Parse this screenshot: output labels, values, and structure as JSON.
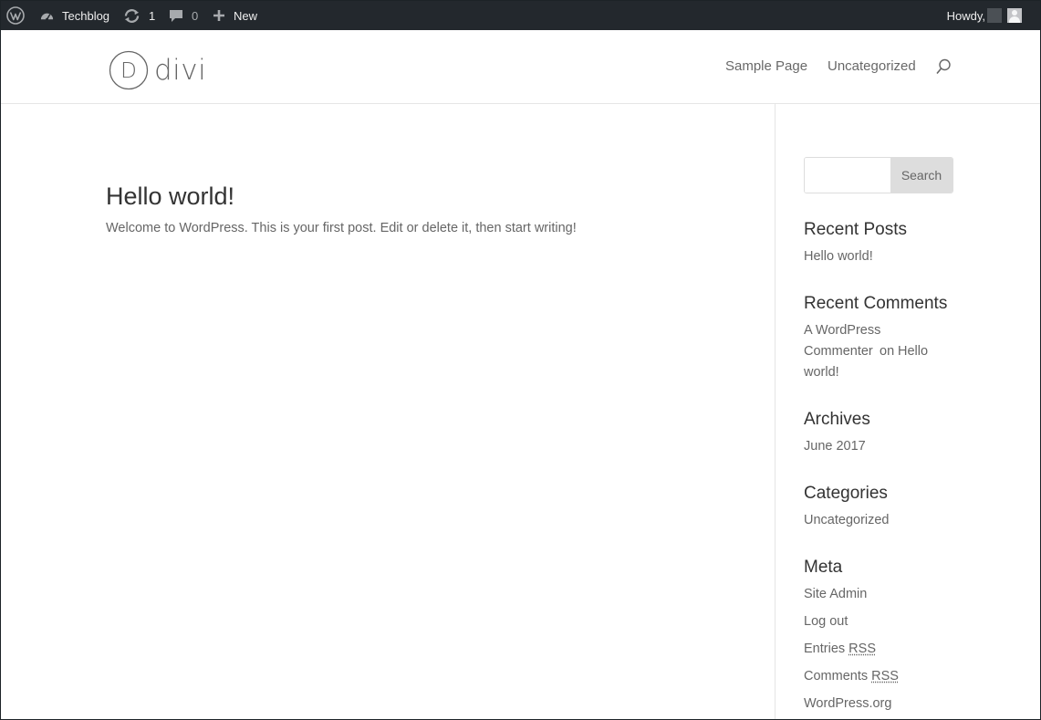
{
  "admin_bar": {
    "site_name": "Techblog",
    "updates_count": "1",
    "comments_count": "0",
    "new_label": "New",
    "howdy_label": "Howdy,"
  },
  "header": {
    "logo_letter": "D",
    "logo_text": "divi",
    "nav": [
      {
        "label": "Sample Page"
      },
      {
        "label": "Uncategorized"
      }
    ]
  },
  "post": {
    "title": "Hello world!",
    "body": "Welcome to WordPress. This is your first post. Edit or delete it, then start writing!"
  },
  "sidebar": {
    "search": {
      "placeholder": "",
      "button_label": "Search"
    },
    "recent_posts": {
      "title": "Recent Posts",
      "items": [
        "Hello world!"
      ]
    },
    "recent_comments": {
      "title": "Recent Comments",
      "author": "A WordPress",
      "author2": "Commenter",
      "on": "on",
      "post": "Hello",
      "post2": "world!"
    },
    "archives": {
      "title": "Archives",
      "items": [
        "June 2017"
      ]
    },
    "categories": {
      "title": "Categories",
      "items": [
        "Uncategorized"
      ]
    },
    "meta": {
      "title": "Meta",
      "site_admin": "Site Admin",
      "log_out": "Log out",
      "entries": "Entries",
      "comments": "Comments",
      "rss": "RSS",
      "wordpress_org": "WordPress.org"
    }
  },
  "colors": {
    "admin_bar_bg": "#23282d",
    "text_dark": "#333333",
    "text_muted": "#666666",
    "button_bg": "#dddddd"
  }
}
